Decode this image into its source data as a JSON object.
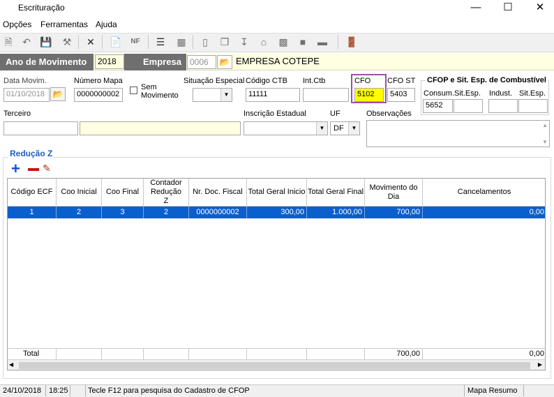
{
  "window": {
    "title": "Escrituração"
  },
  "menu": {
    "opcoes": "Opções",
    "ferramentas": "Ferramentas",
    "ajuda": "Ajuda"
  },
  "header": {
    "ano_label": "Ano de Movimento",
    "ano_value": "2018",
    "empresa_label": "Empresa",
    "empresa_code": "0006",
    "empresa_name": "EMPRESA COTEPE"
  },
  "form": {
    "data_movim_label": "Data Movim.",
    "data_movim_value": "01/10/2018",
    "numero_mapa_label": "Número Mapa",
    "numero_mapa_value": "0000000002",
    "sem_movimento_label_1": "Sem",
    "sem_movimento_label_2": "Movimento",
    "situacao_label": "Situação Especial",
    "codigo_ctb_label": "Código CTB",
    "codigo_ctb_value": "11111",
    "int_ctb_label": "Int.Ctb",
    "cfo_label": "CFO",
    "cfo_value": "5102",
    "cfo_st_label": "CFO ST",
    "cfo_st_value": "5403",
    "combust_group_title": "CFOP e Sit. Esp. de Combustível",
    "consum_label": "Consum.",
    "consum_value": "5652",
    "sit_esp_label": "Sit.Esp.",
    "indust_label": "Indust.",
    "sit_esp2_label": "Sit.Esp.",
    "terceiro_label": "Terceiro",
    "inscricao_label": "Inscrição Estadual",
    "uf_label": "UF",
    "uf_value": "DF",
    "observacoes_label": "Observações"
  },
  "reducao": {
    "title": "Redução Z",
    "columns": [
      "Código ECF",
      "Coo Inicial",
      "Coo Final",
      "Contador Redução Z",
      "Nr. Doc. Fiscal",
      "Total Geral Inicio",
      "Total Geral Final",
      "Movimento do Dia",
      "Cancelamentos"
    ],
    "rows": [
      [
        "1",
        "2",
        "3",
        "2",
        "0000000002",
        "300,00",
        "1.000,00",
        "700,00",
        "0,00"
      ]
    ],
    "total_label": "Total",
    "total_movimento": "700,00",
    "total_cancelamentos": "0,00"
  },
  "status": {
    "date": "24/10/2018",
    "time": "18:25",
    "message": "Tecle F12 para pesquisa do Cadastro de CFOP",
    "screen": "Mapa Resumo"
  },
  "colors": {
    "highlight": "#ffff00",
    "selection": "#0a5fcf",
    "cfo_border": "#9b4fa8",
    "header_dark": "#6f6f6f"
  }
}
